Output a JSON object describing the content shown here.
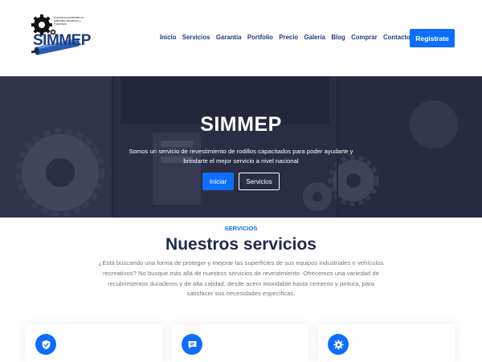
{
  "header": {
    "logo": {
      "brand": "SIMMEP",
      "tagline": "Soluciones Industriales en Materiales Mecánicos y Poliuretano"
    },
    "nav": [
      "Inicio",
      "Servicios",
      "Garantía",
      "Portfolio",
      "Precio",
      "Galería",
      "Blog",
      "Comprar",
      "Contacto"
    ],
    "register_label": "Registrate"
  },
  "hero": {
    "title": "SIMMEP",
    "subtitle": "Somos un servicio de revestimiento de rodillos capacitados para poder ayudarte y brindarte el mejor servicio a nivel nacional",
    "primary_button": "Iniciar",
    "secondary_button": "Servicios"
  },
  "services": {
    "label": "SERVICIOS",
    "title": "Nuestros servicios",
    "description": "¿Está buscando una forma de proteger y mejorar las superficies de sus equipos industriales o vehículos recreativos? No busque más allá de nuestros servicios de revestimiento. Ofrecemos una variedad de recubrimientos duraderos y de alta calidad, desde acero inoxidable hasta cemento y pintura, para satisfacer sus necesidades específicas.",
    "cards": [
      {
        "icon": "shield-check-icon"
      },
      {
        "icon": "chat-bubble-icon"
      },
      {
        "icon": "gear-icon"
      }
    ]
  },
  "colors": {
    "accent": "#0d6efd",
    "brand_navy": "#1c3d7a",
    "title_dark": "#1c2b4a"
  }
}
